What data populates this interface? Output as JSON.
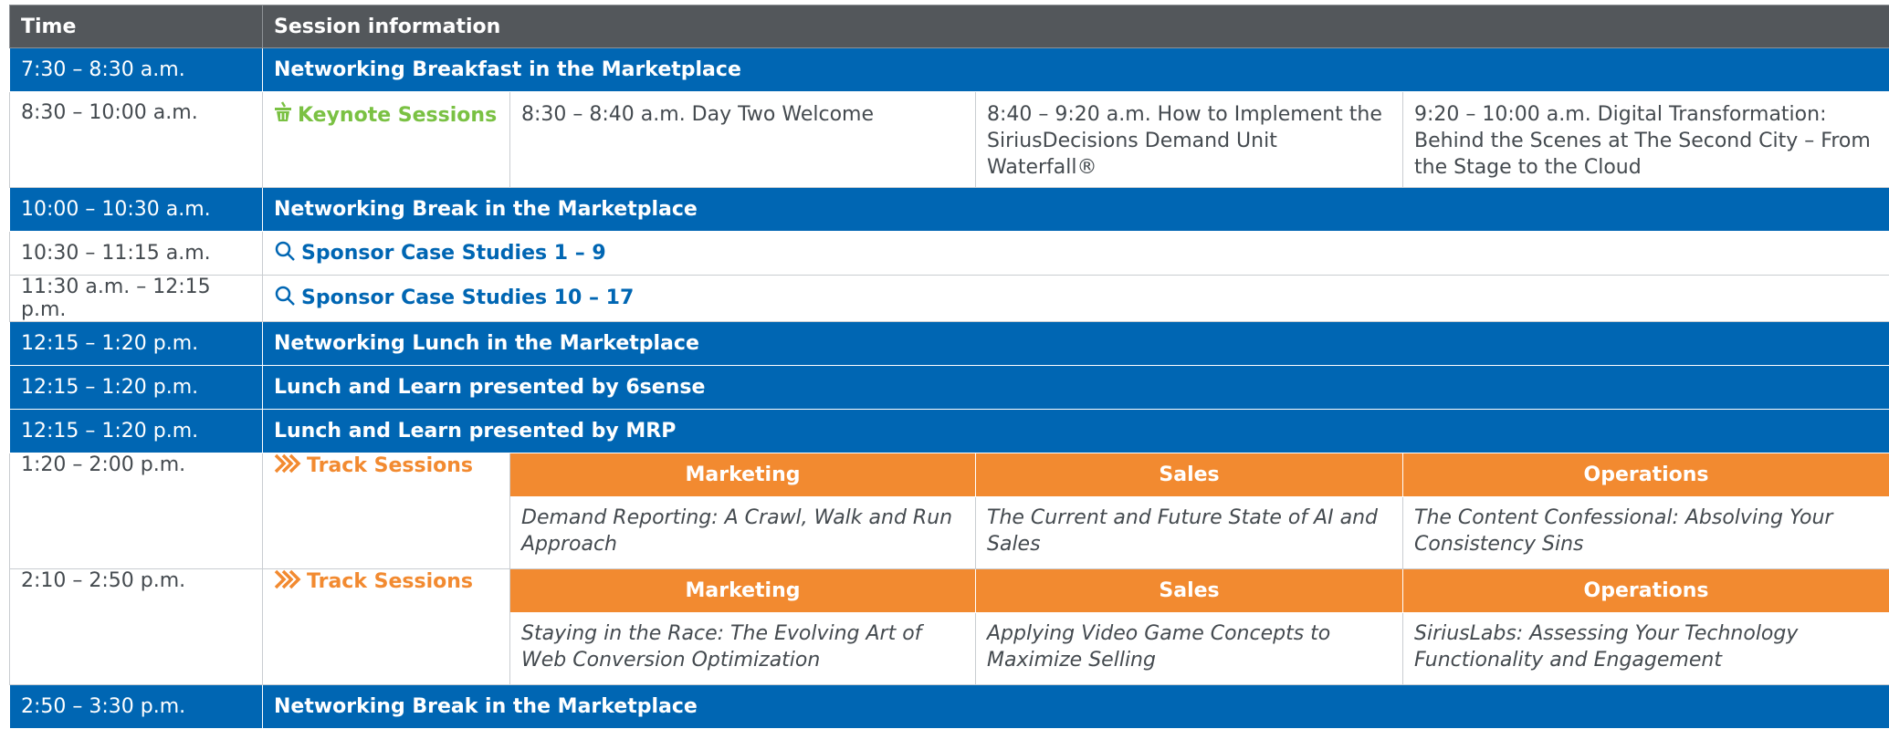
{
  "header": {
    "time_label": "Time",
    "session_label": "Session information"
  },
  "colors": {
    "header_bg": "#53575b",
    "blue": "#0066b3",
    "orange": "#f28a30",
    "green": "#7ac143",
    "border": "#c9cdd1"
  },
  "rows": {
    "r1": {
      "time": "7:30 – 8:30 a.m.",
      "session": "Networking Breakfast in the Marketplace"
    },
    "r2": {
      "time": "8:30 – 10:00 a.m.",
      "label": "Keynote Sessions",
      "icon": "basket-icon",
      "s1": "8:30 – 8:40 a.m. Day Two Welcome",
      "s2": "8:40 – 9:20 a.m. How to Implement the SiriusDecisions Demand Unit Waterfall®",
      "s3": "9:20 – 10:00 a.m. Digital Transformation: Behind the Scenes at The Second City – From the Stage to the Cloud"
    },
    "r3": {
      "time": "10:00 – 10:30 a.m.",
      "session": "Networking Break in the Marketplace"
    },
    "r4": {
      "time": "10:30 – 11:15 a.m.",
      "session": "Sponsor Case Studies 1 – 9",
      "icon": "search-icon"
    },
    "r5": {
      "time": "11:30 a.m. – 12:15 p.m.",
      "session": "Sponsor Case Studies 10 – 17",
      "icon": "search-icon"
    },
    "r6": {
      "time": "12:15 – 1:20 p.m.",
      "session": "Networking Lunch in the Marketplace"
    },
    "r7": {
      "time": "12:15 – 1:20 p.m.",
      "session": "Lunch and Learn presented by 6sense"
    },
    "r8": {
      "time": "12:15 – 1:20 p.m.",
      "session": "Lunch and Learn presented by MRP"
    },
    "t1": {
      "time": "1:20 – 2:00 p.m.",
      "label": "Track Sessions",
      "icon": "fast-forward-icon",
      "h1": "Marketing",
      "h2": "Sales",
      "h3": "Operations",
      "s1": "Demand Reporting: A Crawl, Walk and Run Approach",
      "s2": "The Current and Future State of AI and Sales",
      "s3": "The Content Confessional: Absolving Your Consistency Sins"
    },
    "t2": {
      "time": "2:10 – 2:50 p.m.",
      "label": "Track Sessions",
      "icon": "fast-forward-icon",
      "h1": "Marketing",
      "h2": "Sales",
      "h3": "Operations",
      "s1": "Staying in the Race: The Evolving Art of Web Conversion Optimization",
      "s2": "Applying Video Game Concepts to Maximize Selling",
      "s3": "SiriusLabs: Assessing Your Technology Functionality and Engagement"
    },
    "r9": {
      "time": "2:50 – 3:30 p.m.",
      "session": "Networking Break in the Marketplace"
    }
  }
}
